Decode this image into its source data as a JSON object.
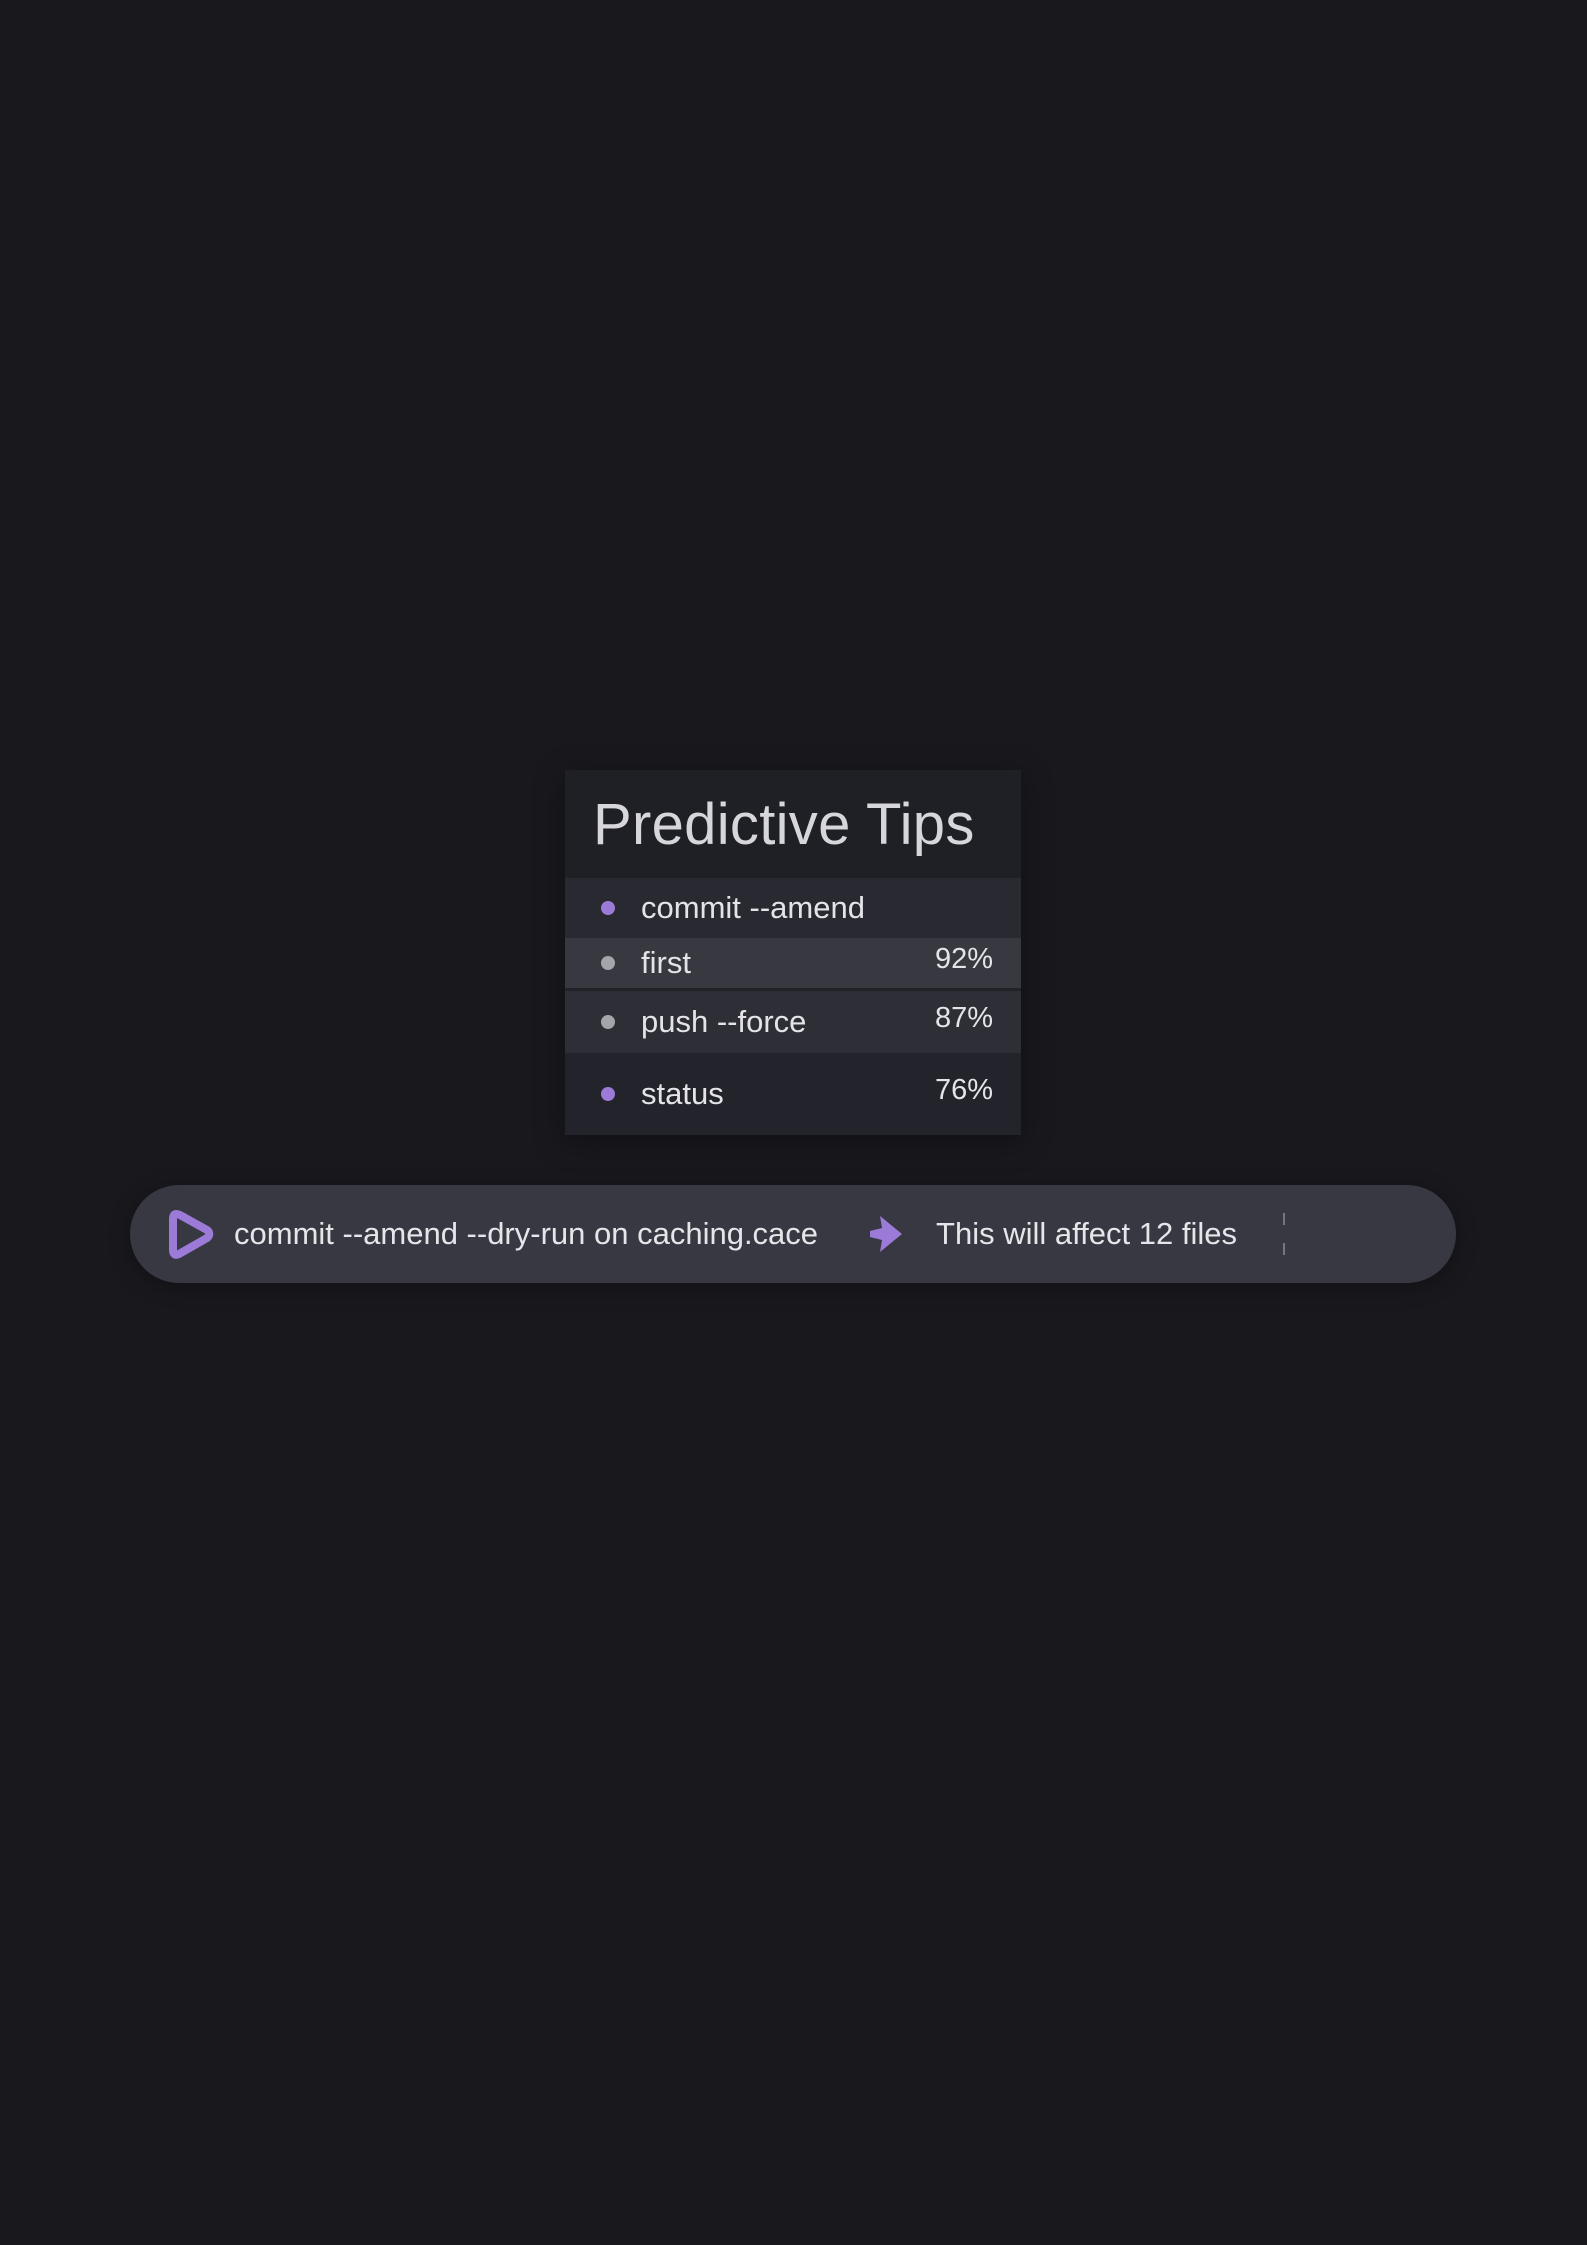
{
  "panel": {
    "title": "Predictive Tips",
    "items": [
      {
        "label": "commit --amend",
        "percent": "",
        "dot": "accent"
      },
      {
        "label": "first",
        "percent": "92%",
        "dot": "muted"
      },
      {
        "label": "push --force",
        "percent": "87%",
        "dot": "muted"
      },
      {
        "label": "status",
        "percent": "76%",
        "dot": "accent"
      }
    ]
  },
  "command_bar": {
    "command": "commit --amend --dry-run on caching.cace",
    "info": "This will affect 12 files",
    "logo_icon": "play-logo-icon",
    "arrow_icon": "arrow-right-icon"
  },
  "colors": {
    "background": "#19181d",
    "panel": "#222329",
    "bar": "#373841",
    "accent": "#9c7ad8",
    "muted_dot": "#a4a4aa"
  }
}
